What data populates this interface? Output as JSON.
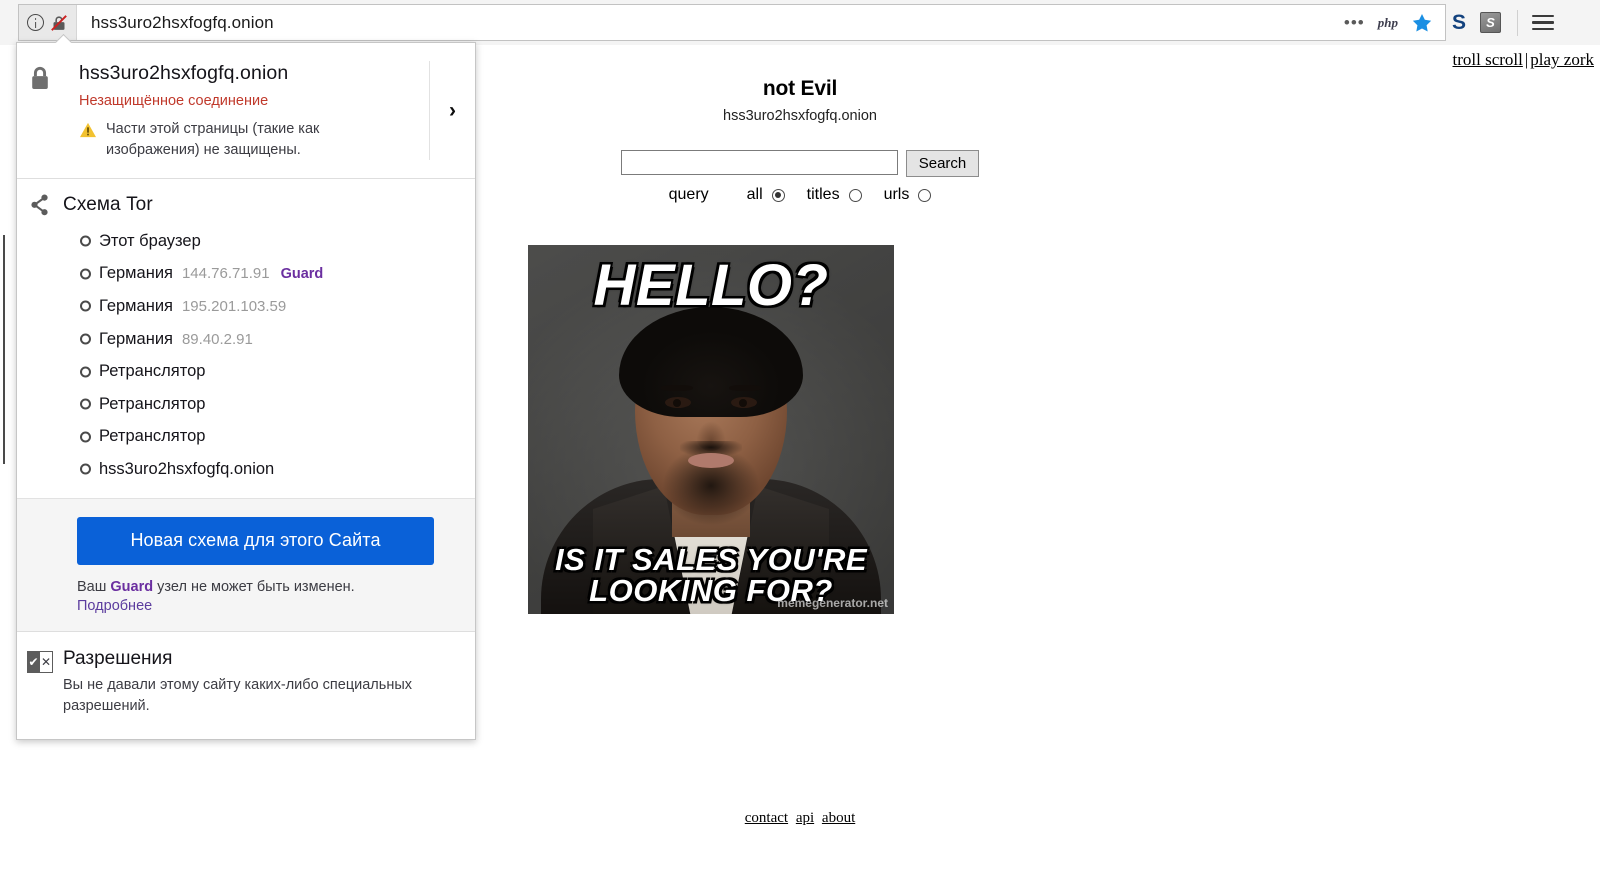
{
  "browser": {
    "url": "hss3uro2hsxfogfq.onion",
    "identity_icons": [
      "info-icon",
      "broken-lock-icon"
    ],
    "toolbar_icons": [
      "more-dots-icon",
      "php-icon",
      "bookmark-star-icon",
      "s-extension-icon",
      "s-box-extension-icon",
      "hamburger-menu-icon"
    ],
    "php_label": "php",
    "s_blue_label": "S",
    "s_box_label": "S"
  },
  "popup": {
    "site_host": "hss3uro2hsxfogfq.onion",
    "connection_status": "Незащищённое соединение",
    "mixed_content_warning": "Части этой страницы (такие как изображения) не защищены.",
    "expand_chevron": "›",
    "circuit": {
      "title": "Схема Tor",
      "nodes": [
        {
          "label": "Этот браузер",
          "ip": "",
          "badge": ""
        },
        {
          "label": "Германия",
          "ip": "144.76.71.91",
          "badge": "Guard"
        },
        {
          "label": "Германия",
          "ip": "195.201.103.59",
          "badge": ""
        },
        {
          "label": "Германия",
          "ip": "89.40.2.91",
          "badge": ""
        },
        {
          "label": "Ретранслятор",
          "ip": "",
          "badge": ""
        },
        {
          "label": "Ретранслятор",
          "ip": "",
          "badge": ""
        },
        {
          "label": "Ретранслятор",
          "ip": "",
          "badge": ""
        },
        {
          "label": "hss3uro2hsxfogfq.onion",
          "ip": "",
          "badge": ""
        }
      ]
    },
    "new_circuit_button": "Новая схема для этого Сайта",
    "guard_note_prefix": "Ваш ",
    "guard_note_badge": "Guard",
    "guard_note_suffix": " узел не может быть изменен.",
    "learn_more": "Подробнее",
    "permissions": {
      "title": "Разрешения",
      "text": "Вы не давали этому сайту каких-либо специальных разрешений."
    },
    "colors": {
      "insecure_red": "#c0392b",
      "guard_purple": "#6b2fa0",
      "button_blue": "#0a61d8",
      "link_purple": "#5b3c9e",
      "warning_yellow": "#f2c230"
    }
  },
  "page": {
    "top_links": [
      {
        "label": "troll scroll"
      },
      {
        "label": "play zork"
      }
    ],
    "top_links_separator": "|",
    "site_name": "not Evil",
    "site_host": "hss3uro2hsxfogfq.onion",
    "search": {
      "value": "",
      "placeholder": "",
      "button_label": "Search"
    },
    "scope": {
      "query_label": "query",
      "options": [
        {
          "label": "all",
          "selected": true
        },
        {
          "label": "titles",
          "selected": false
        },
        {
          "label": "urls",
          "selected": false
        }
      ]
    },
    "meme": {
      "top_text": "Hello?",
      "bottom_text": "Is it sales you're looking for?",
      "watermark": "memegenerator.net"
    },
    "footer_links": [
      {
        "label": "contact"
      },
      {
        "label": "api"
      },
      {
        "label": "about"
      }
    ]
  }
}
